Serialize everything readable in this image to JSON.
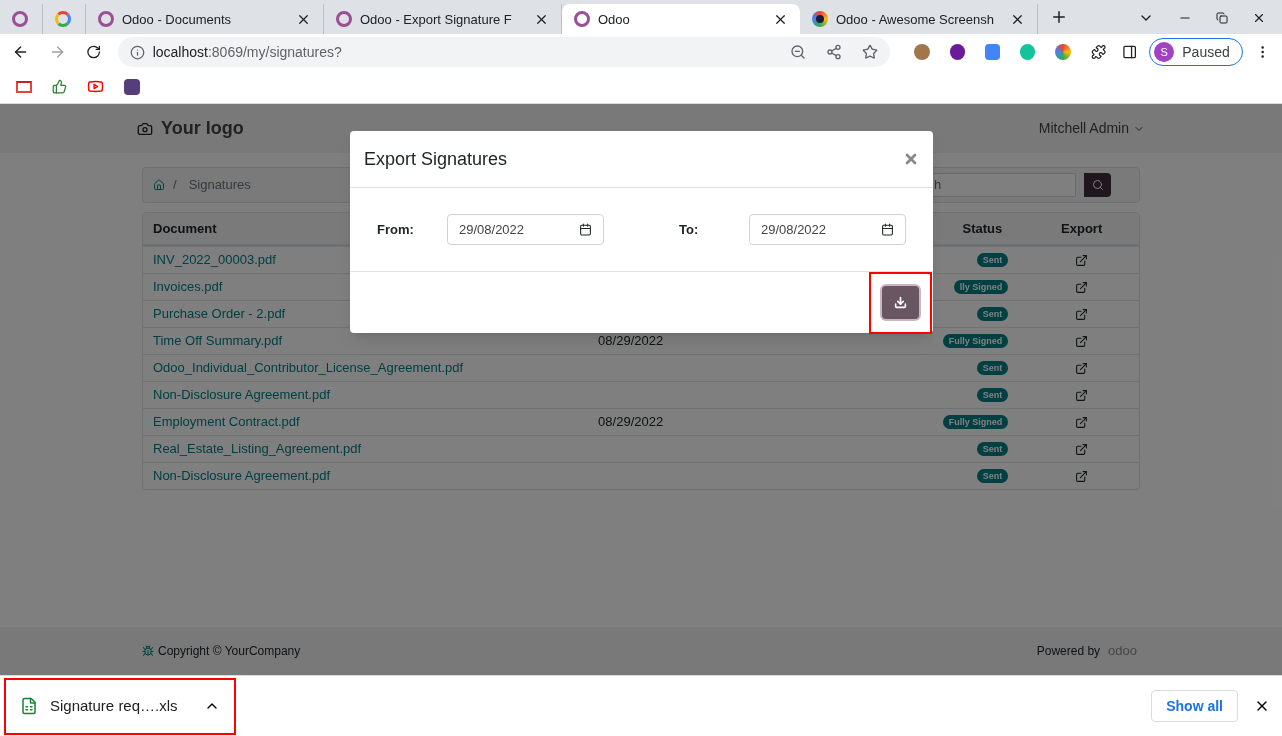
{
  "browser": {
    "tabs": [
      {
        "kind": "odoo",
        "selected": false
      },
      {
        "kind": "google",
        "selected": false
      },
      {
        "kind": "odoo",
        "title": "Odoo - Documents",
        "selected": false
      },
      {
        "kind": "odoo",
        "title": "Odoo - Export Signature F",
        "selected": false
      },
      {
        "kind": "odoo",
        "title": "Odoo",
        "selected": true
      },
      {
        "kind": "screenshot",
        "title": "Odoo - Awesome Screensh",
        "selected": false
      }
    ],
    "address": {
      "host": "localhost",
      "path": ":8069/my/signatures?"
    },
    "profile": {
      "initial": "S",
      "status": "Paused"
    }
  },
  "page": {
    "logo": "Your logo",
    "user": "Mitchell Admin",
    "breadcrumb_separator": "/",
    "breadcrumb": "Signatures",
    "search": {
      "placeholder": "h"
    },
    "table": {
      "columns": {
        "document": "Document",
        "status": "Status",
        "export": "Export"
      },
      "rows": [
        {
          "document": "INV_2022_00003.pdf",
          "status": "Sent"
        },
        {
          "document": "Invoices.pdf",
          "status": "lly Signed"
        },
        {
          "document": "Purchase Order - 2.pdf",
          "status": "Sent"
        },
        {
          "document": "Time Off Summary.pdf",
          "date": "08/29/2022",
          "status": "Fully Signed"
        },
        {
          "document": "Odoo_Individual_Contributor_License_Agreement.pdf",
          "status": "Sent"
        },
        {
          "document": "Non-Disclosure Agreement.pdf",
          "status": "Sent"
        },
        {
          "document": "Employment Contract.pdf",
          "date": "08/29/2022",
          "status": "Fully Signed"
        },
        {
          "document": "Real_Estate_Listing_Agreement.pdf",
          "status": "Sent"
        },
        {
          "document": "Non-Disclosure Agreement.pdf",
          "status": "Sent"
        }
      ]
    },
    "footer": {
      "copyright": "Copyright © YourCompany",
      "powered_by": "Powered by",
      "brand": "odoo"
    }
  },
  "modal": {
    "title": "Export Signatures",
    "fields": [
      {
        "label": "From:",
        "value": "29/08/2022"
      },
      {
        "label": "To:",
        "value": "29/08/2022"
      }
    ],
    "download_button": {
      "highlighted": true
    }
  },
  "downloads": {
    "items": [
      {
        "name": "Signature req….xls",
        "highlighted": true
      }
    ],
    "show_all": "Show all"
  }
}
